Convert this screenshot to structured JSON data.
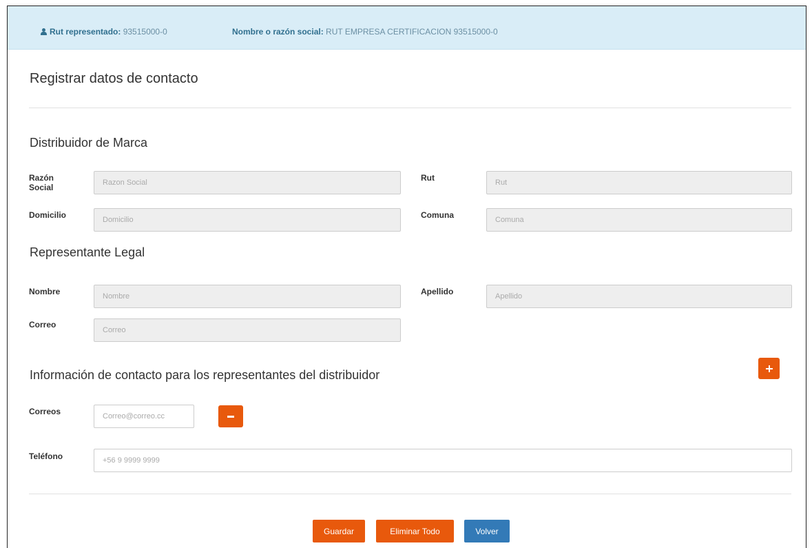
{
  "header": {
    "rut_label": "Rut representado:",
    "rut_value": "93515000-0",
    "name_label": "Nombre o razón social:",
    "name_value": "RUT EMPRESA CERTIFICACION 93515000-0"
  },
  "page_title": "Registrar datos de contacto",
  "distribuidor": {
    "title": "Distribuidor de Marca",
    "razon_social_label": "Razón Social",
    "razon_social_placeholder": "Razon Social",
    "rut_label": "Rut",
    "rut_placeholder": "Rut",
    "domicilio_label": "Domicilio",
    "domicilio_placeholder": "Domicilio",
    "comuna_label": "Comuna",
    "comuna_placeholder": "Comuna"
  },
  "representante": {
    "title": "Representante Legal",
    "nombre_label": "Nombre",
    "nombre_placeholder": "Nombre",
    "apellido_label": "Apellido",
    "apellido_placeholder": "Apellido",
    "correo_label": "Correo",
    "correo_placeholder": "Correo"
  },
  "contacto": {
    "title": "Información de contacto para los representantes del distribuidor",
    "correos_label": "Correos",
    "correos_placeholder": "Correo@correo.cc",
    "telefono_label": "Teléfono",
    "telefono_placeholder": "+56 9 9999 9999"
  },
  "actions": {
    "guardar": "Guardar",
    "eliminar_todo": "Eliminar Todo",
    "volver": "Volver"
  },
  "colors": {
    "accent_orange": "#e8590c",
    "accent_blue": "#337ab7",
    "info_bar": "#d9edf7"
  }
}
